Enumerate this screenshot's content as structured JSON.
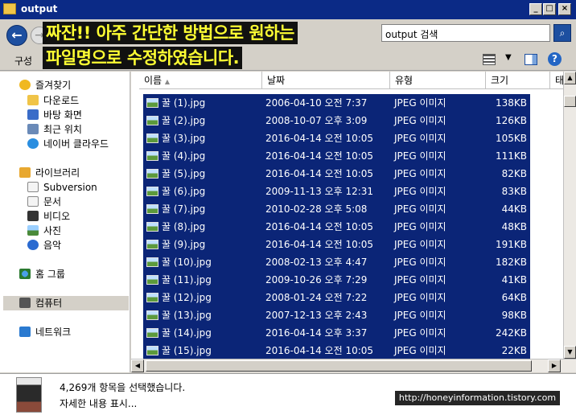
{
  "window": {
    "title": "output"
  },
  "address": {
    "search_placeholder": "output 검색"
  },
  "toolbar": {
    "organize_label": "구성"
  },
  "banner": {
    "line1": "짜잔!! 아주 간단한 방법으로 원하는",
    "line2": "파일명으로 수정하였습니다."
  },
  "sidebar": {
    "items": [
      {
        "label": "즐겨찾기",
        "icon": "star-icon"
      },
      {
        "label": "다운로드",
        "icon": "download-folder-icon"
      },
      {
        "label": "바탕 화면",
        "icon": "desktop-icon"
      },
      {
        "label": "최근 위치",
        "icon": "recent-places-icon"
      },
      {
        "label": "네이버 클라우드",
        "icon": "cloud-icon"
      },
      {
        "label": "라이브러리",
        "icon": "library-icon"
      },
      {
        "label": "Subversion",
        "icon": "document-icon"
      },
      {
        "label": "문서",
        "icon": "document-icon"
      },
      {
        "label": "비디오",
        "icon": "video-icon"
      },
      {
        "label": "사진",
        "icon": "picture-icon"
      },
      {
        "label": "음악",
        "icon": "music-icon"
      },
      {
        "label": "홈 그룹",
        "icon": "homegroup-icon"
      },
      {
        "label": "컴퓨터",
        "icon": "computer-icon"
      },
      {
        "label": "네트워크",
        "icon": "network-icon"
      }
    ]
  },
  "columns": {
    "name": "이름",
    "date": "날짜",
    "type": "유형",
    "size": "크기",
    "extra": "태"
  },
  "files": [
    {
      "name": "꿀 (1).jpg",
      "date": "2006-04-10 오전 7:37",
      "type": "JPEG 이미지",
      "size": "138KB"
    },
    {
      "name": "꿀 (2).jpg",
      "date": "2008-10-07 오후 3:09",
      "type": "JPEG 이미지",
      "size": "126KB"
    },
    {
      "name": "꿀 (3).jpg",
      "date": "2016-04-14 오전 10:05",
      "type": "JPEG 이미지",
      "size": "105KB"
    },
    {
      "name": "꿀 (4).jpg",
      "date": "2016-04-14 오전 10:05",
      "type": "JPEG 이미지",
      "size": "111KB"
    },
    {
      "name": "꿀 (5).jpg",
      "date": "2016-04-14 오전 10:05",
      "type": "JPEG 이미지",
      "size": "82KB"
    },
    {
      "name": "꿀 (6).jpg",
      "date": "2009-11-13 오후 12:31",
      "type": "JPEG 이미지",
      "size": "83KB"
    },
    {
      "name": "꿀 (7).jpg",
      "date": "2010-02-28 오후 5:08",
      "type": "JPEG 이미지",
      "size": "44KB"
    },
    {
      "name": "꿀 (8).jpg",
      "date": "2016-04-14 오전 10:05",
      "type": "JPEG 이미지",
      "size": "48KB"
    },
    {
      "name": "꿀 (9).jpg",
      "date": "2016-04-14 오전 10:05",
      "type": "JPEG 이미지",
      "size": "191KB"
    },
    {
      "name": "꿀 (10).jpg",
      "date": "2008-02-13 오후 4:47",
      "type": "JPEG 이미지",
      "size": "182KB"
    },
    {
      "name": "꿀 (11).jpg",
      "date": "2009-10-26 오후 7:29",
      "type": "JPEG 이미지",
      "size": "41KB"
    },
    {
      "name": "꿀 (12).jpg",
      "date": "2008-01-24 오전 7:22",
      "type": "JPEG 이미지",
      "size": "64KB"
    },
    {
      "name": "꿀 (13).jpg",
      "date": "2007-12-13 오후 2:43",
      "type": "JPEG 이미지",
      "size": "98KB"
    },
    {
      "name": "꿀 (14).jpg",
      "date": "2016-04-14 오후 3:37",
      "type": "JPEG 이미지",
      "size": "242KB"
    },
    {
      "name": "꿀 (15).jpg",
      "date": "2016-04-14 오전 10:05",
      "type": "JPEG 이미지",
      "size": "22KB"
    }
  ],
  "details": {
    "selection_text": "4,269개 항목을 선택했습니다.",
    "more_text": "자세한 내용 표시..."
  },
  "watermark": "http://honeyinformation.tistory.com",
  "colors": {
    "selection": "#0b2577",
    "titlebar": "#0b2a86",
    "banner_text": "#ffff33"
  }
}
